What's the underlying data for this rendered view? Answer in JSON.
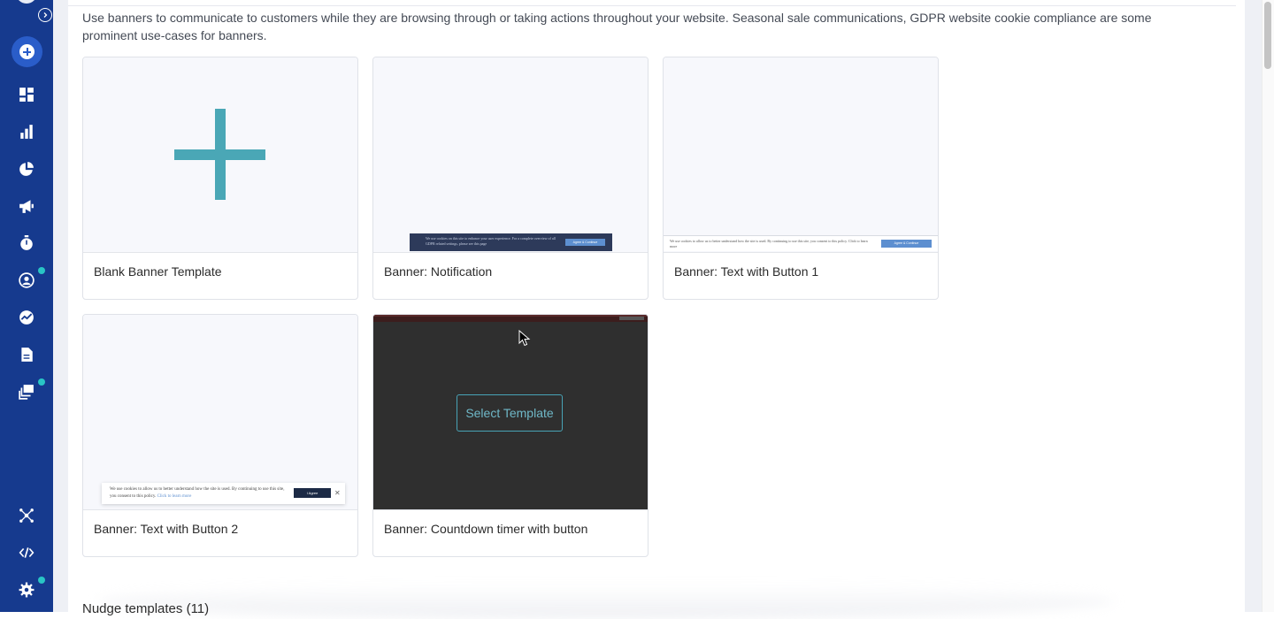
{
  "description": "Use banners to communicate to customers while they are browsing through or taking actions throughout your website. Seasonal sale communications, GDPR website cookie compliance are some prominent use-cases for banners.",
  "sidebar": {
    "items": [
      {
        "icon": "dashboard-icon"
      },
      {
        "icon": "analytics-icon"
      },
      {
        "icon": "segments-icon"
      },
      {
        "icon": "campaigns-icon"
      },
      {
        "icon": "timer-icon"
      },
      {
        "icon": "user-profile-icon",
        "badge": true
      },
      {
        "icon": "insights-icon"
      },
      {
        "icon": "documents-icon"
      },
      {
        "icon": "templates-icon",
        "badge": true
      },
      {
        "icon": "integrations-icon"
      },
      {
        "icon": "code-icon"
      },
      {
        "icon": "settings-icon",
        "badge": true
      }
    ]
  },
  "templates": [
    {
      "label": "Blank Banner Template"
    },
    {
      "label": "Banner: Notification",
      "preview_text": "We use cookies on this site to enhance your user experience. For a complete overview of all GDPR related settings, please see this page",
      "preview_button": "Agree & Continue"
    },
    {
      "label": "Banner: Text with Button 1",
      "preview_text": "We use cookies to allow us to better understand how the site is used. By continuing to use this site, you consent to this policy. Click to learn more",
      "preview_button": "Agree & Continue"
    },
    {
      "label": "Banner: Text with Button 2",
      "preview_text": "We use cookies to allow us to better understand how the site is used. By continuing to use this site, you consent to this policy.",
      "preview_link": "Click to learn more",
      "preview_button": "I Agree",
      "preview_close": "✕"
    },
    {
      "label": "Banner: Countdown timer with button",
      "hover_button": "Select Template"
    }
  ],
  "next_section": {
    "title": "Nudge templates (11)"
  },
  "colors": {
    "sidebar": "#163a8e",
    "accent": "#4aa7b6",
    "badge": "#29c5c5"
  }
}
